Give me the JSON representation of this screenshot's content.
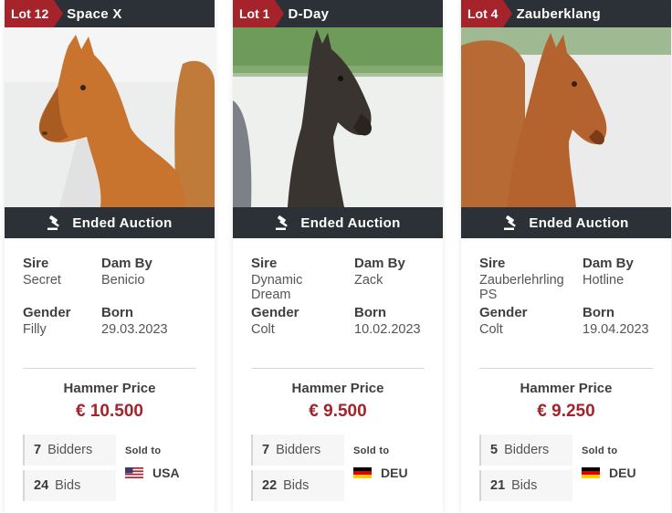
{
  "colors": {
    "dark": "#2b3136",
    "accent": "#a5232b"
  },
  "cards": [
    {
      "lot": "Lot 12",
      "name": "Space X",
      "status": "Ended Auction",
      "sire_label": "Sire",
      "sire": "Secret",
      "dam_label": "Dam By",
      "dam": "Benicio",
      "gender_label": "Gender",
      "gender": "Filly",
      "born_label": "Born",
      "born": "29.03.2023",
      "hammer_label": "Hammer Price",
      "price": "€ 10.500",
      "bidders_count": "7",
      "bidders_label": "Bidders",
      "bids_count": "24",
      "bids_label": "Bids",
      "sold_to_label": "Sold to",
      "country": "USA",
      "flag_icon": "usa-flag-icon"
    },
    {
      "lot": "Lot 1",
      "name": "D-Day",
      "status": "Ended Auction",
      "sire_label": "Sire",
      "sire": "Dynamic Dream",
      "dam_label": "Dam By",
      "dam": "Zack",
      "gender_label": "Gender",
      "gender": "Colt",
      "born_label": "Born",
      "born": "10.02.2023",
      "hammer_label": "Hammer Price",
      "price": "€ 9.500",
      "bidders_count": "7",
      "bidders_label": "Bidders",
      "bids_count": "22",
      "bids_label": "Bids",
      "sold_to_label": "Sold to",
      "country": "DEU",
      "flag_icon": "germany-flag-icon"
    },
    {
      "lot": "Lot 4",
      "name": "Zauberklang",
      "status": "Ended Auction",
      "sire_label": "Sire",
      "sire": "Zauberlehrling PS",
      "dam_label": "Dam By",
      "dam": "Hotline",
      "gender_label": "Gender",
      "gender": "Colt",
      "born_label": "Born",
      "born": "19.04.2023",
      "hammer_label": "Hammer Price",
      "price": "€ 9.250",
      "bidders_count": "5",
      "bidders_label": "Bidders",
      "bids_count": "21",
      "bids_label": "Bids",
      "sold_to_label": "Sold to",
      "country": "DEU",
      "flag_icon": "germany-flag-icon"
    }
  ]
}
